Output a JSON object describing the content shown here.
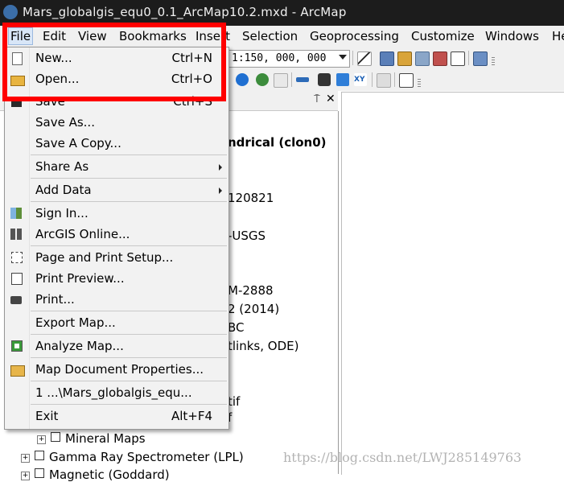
{
  "window": {
    "title": "Mars_globalgis_equ0_0.1_ArcMap10.2.mxd - ArcMap"
  },
  "menubar": {
    "items": [
      "File",
      "Edit",
      "View",
      "Bookmarks",
      "Insert",
      "Selection",
      "Geoprocessing",
      "Customize",
      "Windows",
      "Help"
    ],
    "active": "File"
  },
  "toolbar": {
    "scale_value": "1:150, 000, 000"
  },
  "toc": {
    "pin_glyph": "⍑",
    "close_glyph": "✕",
    "fragments": [
      "ndrical (clon0)",
      "120821",
      "-USGS",
      "M-2888",
      "2 (2014)",
      "BC",
      "tlinks, ODE)",
      "tif",
      "f"
    ],
    "rows": [
      {
        "label": "Mineral Maps"
      },
      {
        "label": "Gamma Ray Spectrometer (LPL)"
      },
      {
        "label": "Magnetic (Goddard)"
      }
    ]
  },
  "file_menu": {
    "items": [
      {
        "label": "New...",
        "shortcut": "Ctrl+N",
        "icon": "new-document-icon"
      },
      {
        "label": "Open...",
        "shortcut": "Ctrl+O",
        "icon": "open-folder-icon"
      },
      {
        "label": "Save",
        "shortcut": "Ctrl+S",
        "icon": "save-disk-icon"
      },
      {
        "label": "Save As...",
        "shortcut": ""
      },
      {
        "label": "Save A Copy...",
        "shortcut": ""
      },
      {
        "label": "Share As",
        "shortcut": "",
        "submenu": true
      },
      {
        "label": "Add Data",
        "shortcut": "",
        "submenu": true
      },
      {
        "label": "Sign In...",
        "shortcut": "",
        "icon": "sign-in-icon"
      },
      {
        "label": "ArcGIS Online...",
        "shortcut": "",
        "icon": "arcgis-online-icon"
      },
      {
        "label": "Page and Print Setup...",
        "shortcut": "",
        "icon": "page-setup-icon"
      },
      {
        "label": "Print Preview...",
        "shortcut": "",
        "icon": "print-preview-icon"
      },
      {
        "label": "Print...",
        "shortcut": "",
        "icon": "printer-icon"
      },
      {
        "label": "Export Map...",
        "shortcut": ""
      },
      {
        "label": "Analyze Map...",
        "shortcut": "",
        "icon": "analyze-map-icon"
      },
      {
        "label": "Map Document Properties...",
        "shortcut": "",
        "icon": "document-properties-icon"
      },
      {
        "label": "1 ...\\Mars_globalgis_equ...",
        "shortcut": ""
      },
      {
        "label": "Exit",
        "shortcut": "Alt+F4"
      }
    ]
  },
  "watermark": "https://blog.csdn.net/LWJ285149763",
  "colors": {
    "highlight_box": "#ff0000",
    "menu_bg": "#f2f2f2",
    "titlebar_bg": "#1c1c1c"
  }
}
